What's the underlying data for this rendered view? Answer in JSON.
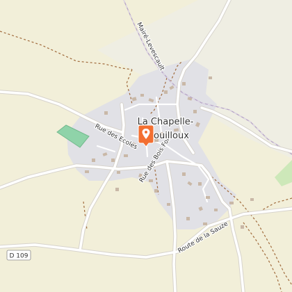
{
  "map": {
    "place_name_line1": "La Chapelle-",
    "place_name_line2": "Bouilloux",
    "streets": {
      "rue_des_ecoles": "Rue des Ecoles",
      "rue_des_bois_forts": "Rue des Bois Forts",
      "route_de_la_sauze": "Route de la Sauze",
      "rail_label": "Mairé-Levescault"
    },
    "road_shield": "D 109",
    "marker": {
      "icon": "map-pin-icon"
    }
  },
  "colors": {
    "farmland": "#f2efd9",
    "field_light": "#efeee3",
    "residential": "#e1e1e6",
    "road": "#ffffff",
    "road_casing": "#d7d3cc",
    "track": "#a06a3b",
    "pitch": "#8fd3a9",
    "marker": "#f36f31",
    "buildings": "#c9b8a7",
    "meadow": "#cde8b9"
  }
}
